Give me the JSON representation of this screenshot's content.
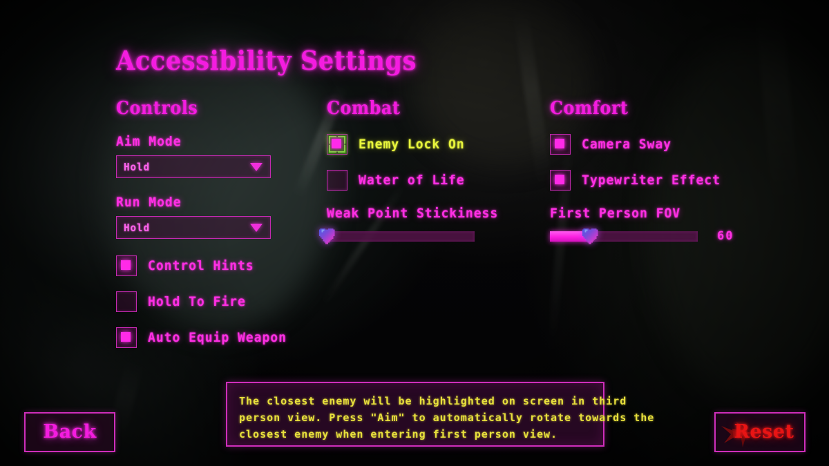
{
  "page_title": "Accessibility Settings",
  "theme": {
    "accent_magenta": "#ff2ae8",
    "accent_magenta_dim": "#c32ab0",
    "selected_green": "#7ddb3a",
    "selected_text_yellow": "#e8f53c",
    "tooltip_text_yellow": "#e8e03c",
    "reset_red": "#e81414",
    "background": "#050506"
  },
  "columns": {
    "controls": {
      "heading": "Controls",
      "dropdowns": [
        {
          "label": "Aim Mode",
          "value": "Hold",
          "arrow_icon": "chevron-down-icon"
        },
        {
          "label": "Run Mode",
          "value": "Hold",
          "arrow_icon": "chevron-down-icon"
        }
      ],
      "checkboxes": [
        {
          "label": "Control Hints",
          "checked": true,
          "selected": false
        },
        {
          "label": "Hold To Fire",
          "checked": false,
          "selected": false
        },
        {
          "label": "Auto Equip Weapon",
          "checked": true,
          "selected": false
        }
      ]
    },
    "combat": {
      "heading": "Combat",
      "checkboxes": [
        {
          "label": "Enemy Lock On",
          "checked": true,
          "selected": true
        },
        {
          "label": "Water of Life",
          "checked": false,
          "selected": false
        }
      ],
      "slider": {
        "label": "Weak Point Stickiness",
        "value": 0,
        "min": 0,
        "max": 100,
        "fill_percent": 0,
        "value_text": "",
        "handle_icon": "heart-slider-handle-icon"
      }
    },
    "comfort": {
      "heading": "Comfort",
      "checkboxes": [
        {
          "label": "Camera Sway",
          "checked": true,
          "selected": false
        },
        {
          "label": "Typewriter Effect",
          "checked": true,
          "selected": false
        }
      ],
      "slider": {
        "label": "First Person FOV",
        "value": 60,
        "min": 0,
        "max": 100,
        "fill_percent": 27,
        "value_text": "60",
        "handle_icon": "heart-slider-handle-icon"
      }
    }
  },
  "tooltip": {
    "line1": "The closest enemy will be highlighted on screen in third",
    "line2": "person view. Press \"Aim\" to automatically rotate towards the",
    "line3": "closest enemy when entering first person view."
  },
  "buttons": {
    "back": "Back",
    "reset": "Reset",
    "reset_icon": "red-slash-icon"
  }
}
